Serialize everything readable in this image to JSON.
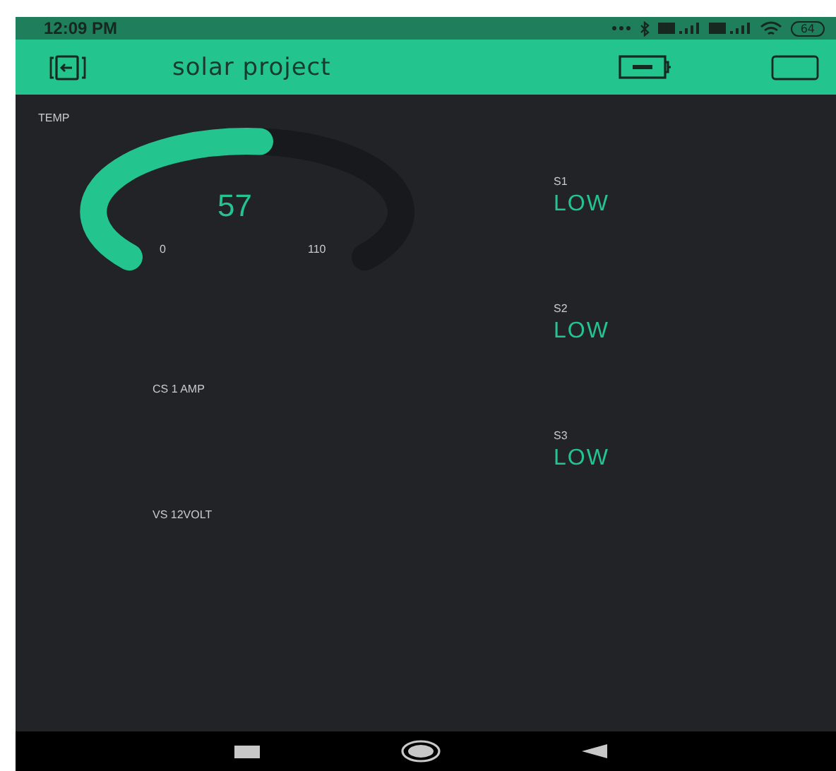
{
  "status_bar": {
    "time": "12:09 PM",
    "battery": "64"
  },
  "app_bar": {
    "title": "solar project"
  },
  "gauge": {
    "label": "TEMP",
    "value": "57",
    "min": "0",
    "max": "110"
  },
  "labels": [
    {
      "label": "CS 1 AMP"
    },
    {
      "label": "VS  12VOLT"
    }
  ],
  "leds": [
    {
      "label": "S1",
      "value": "LOW"
    },
    {
      "label": "S2",
      "value": "LOW"
    },
    {
      "label": "S3",
      "value": "LOW"
    }
  ]
}
